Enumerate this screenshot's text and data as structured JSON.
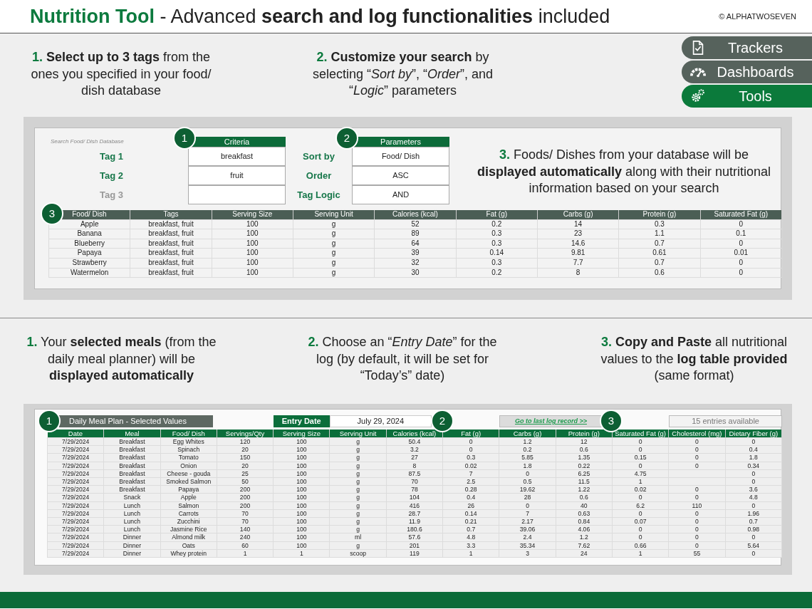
{
  "header": {
    "brand": "Nutrition Tool",
    "tagline": "- Advanced **search and log functionalities** included",
    "copyright": "© ALPHATWOSEVEN"
  },
  "nav_buttons": [
    {
      "label": "Trackers",
      "selected": false
    },
    {
      "label": "Dashboards",
      "selected": false
    },
    {
      "label": "Tools",
      "selected": true
    }
  ],
  "search_section": {
    "steps": [
      {
        "number": "1.",
        "text": "**Select up to 3 tags** from the ones you specified in your food/ dish database"
      },
      {
        "number": "2.",
        "text": "**Customize your search** by selecting “*Sort by*”, “*Order*”, and “*Logic*” parameters"
      },
      {
        "number": "3.",
        "text": "Foods/ Dishes from your database  will be **displayed automatically** along with their nutritional information based on your search"
      }
    ],
    "caption": "Search Food/ Dish Database",
    "criteria_header": "Criteria",
    "parameters_header": "Parameters",
    "badges": [
      "1",
      "2",
      "3"
    ],
    "tags": [
      {
        "label": "Tag 1",
        "value": "breakfast",
        "disabled": false
      },
      {
        "label": "Tag 2",
        "value": "fruit",
        "disabled": false
      },
      {
        "label": "Tag 3",
        "disabled": true
      }
    ],
    "parameters": [
      {
        "label": "Sort by",
        "value": "Food/ Dish"
      },
      {
        "label": "Order",
        "value": "ASC"
      },
      {
        "label": "Tag Logic",
        "value": "AND"
      }
    ],
    "table": {
      "columns": [
        "Food/ Dish",
        "Tags",
        "Serving Size",
        "Serving Unit",
        "Calories (kcal)",
        "Fat (g)",
        "Carbs (g)",
        "Protein (g)",
        "Saturated Fat (g)"
      ],
      "rows": [
        [
          "Apple",
          "breakfast, fruit",
          "100",
          "g",
          "52",
          "0.2",
          "14",
          "0.3",
          "0"
        ],
        [
          "Banana",
          "breakfast, fruit",
          "100",
          "g",
          "89",
          "0.3",
          "23",
          "1.1",
          "0.1"
        ],
        [
          "Blueberry",
          "breakfast, fruit",
          "100",
          "g",
          "64",
          "0.3",
          "14.6",
          "0.7",
          "0"
        ],
        [
          "Papaya",
          "breakfast, fruit",
          "100",
          "g",
          "39",
          "0.14",
          "9.81",
          "0.61",
          "0.01"
        ],
        [
          "Strawberry",
          "breakfast, fruit",
          "100",
          "g",
          "32",
          "0.3",
          "7.7",
          "0.7",
          "0"
        ],
        [
          "Watermelon",
          "breakfast, fruit",
          "100",
          "g",
          "30",
          "0.2",
          "8",
          "0.6",
          "0"
        ]
      ]
    }
  },
  "log_section": {
    "steps": [
      {
        "number": "1.",
        "text": "Your **selected meals** (from the daily meal planner) will be **displayed automatically**"
      },
      {
        "number": "2.",
        "text": "Choose an “*Entry Date*” for the log (by default, it will be set for “Today’s” date)"
      },
      {
        "number": "3.",
        "text": "**Copy and Paste** all nutritional values to the **log table provided** (same format)"
      }
    ],
    "title": "Daily Meal Plan - Selected Values",
    "entry_date_label": "Entry Date",
    "entry_date": "July 29, 2024",
    "link": "Go to last log record >>",
    "entries": "15 entries available",
    "badges": [
      "1",
      "2",
      "3"
    ],
    "table": {
      "columns": [
        "Date",
        "Meal",
        "Food/ Dish",
        "Servings/Qty",
        "Serving Size",
        "Serving Unit",
        "Calories (kcal)",
        "Fat (g)",
        "Carbs (g)",
        "Protein (g)",
        "Saturated Fat (g)",
        "Cholesterol (mg)",
        "Dietary Fiber (g)"
      ],
      "rows": [
        [
          "7/29/2024",
          "Breakfast",
          "Egg Whites",
          "120",
          "100",
          "g",
          "50.4",
          "0",
          "1.2",
          "12",
          "0",
          "0",
          "0"
        ],
        [
          "7/29/2024",
          "Breakfast",
          "Spinach",
          "20",
          "100",
          "g",
          "3.2",
          "0",
          "0.2",
          "0.6",
          "0",
          "0",
          "0.4"
        ],
        [
          "7/29/2024",
          "Breakfast",
          "Tomato",
          "150",
          "100",
          "g",
          "27",
          "0.3",
          "5.85",
          "1.35",
          "0.15",
          "0",
          "1.8"
        ],
        [
          "7/29/2024",
          "Breakfast",
          "Onion",
          "20",
          "100",
          "g",
          "8",
          "0.02",
          "1.8",
          "0.22",
          "0",
          "0",
          "0.34"
        ],
        [
          "7/29/2024",
          "Breakfast",
          "Cheese - gouda",
          "25",
          "100",
          "g",
          "87.5",
          "7",
          "0",
          "6.25",
          "4.75",
          null,
          "0"
        ],
        [
          "7/29/2024",
          "Breakfast",
          "Smoked Salmon",
          "50",
          "100",
          "g",
          "70",
          "2.5",
          "0.5",
          "11.5",
          "1",
          null,
          "0"
        ],
        [
          "7/29/2024",
          "Breakfast",
          "Papaya",
          "200",
          "100",
          "g",
          "78",
          "0.28",
          "19.62",
          "1.22",
          "0.02",
          "0",
          "3.6"
        ],
        [
          "7/29/2024",
          "Snack",
          "Apple",
          "200",
          "100",
          "g",
          "104",
          "0.4",
          "28",
          "0.6",
          "0",
          "0",
          "4.8"
        ],
        [
          "7/29/2024",
          "Lunch",
          "Salmon",
          "200",
          "100",
          "g",
          "416",
          "26",
          "0",
          "40",
          "6.2",
          "110",
          "0"
        ],
        [
          "7/29/2024",
          "Lunch",
          "Carrots",
          "70",
          "100",
          "g",
          "28.7",
          "0.14",
          "7",
          "0.63",
          "0",
          "0",
          "1.96"
        ],
        [
          "7/29/2024",
          "Lunch",
          "Zucchini",
          "70",
          "100",
          "g",
          "11.9",
          "0.21",
          "2.17",
          "0.84",
          "0.07",
          "0",
          "0.7"
        ],
        [
          "7/29/2024",
          "Lunch",
          "Jasmine Rice",
          "140",
          "100",
          "g",
          "180.6",
          "0.7",
          "39.06",
          "4.06",
          "0",
          "0",
          "0.98"
        ],
        [
          "7/29/2024",
          "Dinner",
          "Almond milk",
          "240",
          "100",
          "ml",
          "57.6",
          "4.8",
          "2.4",
          "1.2",
          "0",
          "0",
          "0"
        ],
        [
          "7/29/2024",
          "Dinner",
          "Oats",
          "60",
          "100",
          "g",
          "201",
          "3.3",
          "35.34",
          "7.62",
          "0.66",
          "0",
          "5.64"
        ],
        [
          "7/29/2024",
          "Dinner",
          "Whey protein",
          "1",
          "1",
          "scoop",
          "119",
          "1",
          "3",
          "24",
          "1",
          "55",
          "0"
        ]
      ]
    }
  }
}
